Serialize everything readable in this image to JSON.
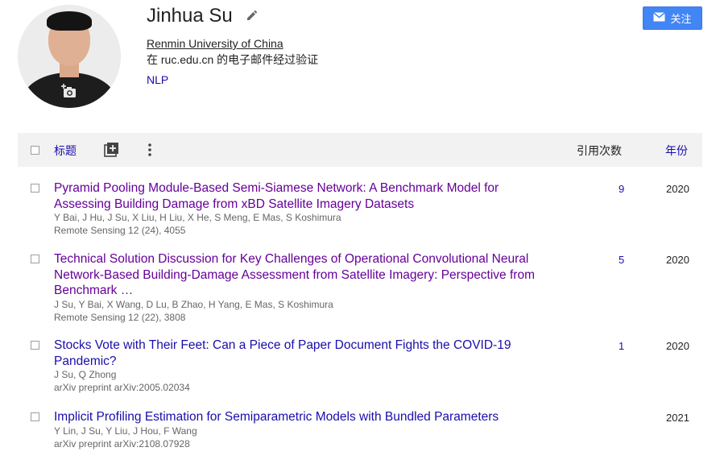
{
  "colors": {
    "link": "#1a0dab",
    "visited": "#660099",
    "accent": "#4285f4"
  },
  "profile": {
    "name": "Jinhua Su",
    "affiliation": "Renmin University of China",
    "verified": "在 ruc.edu.cn 的电子邮件经过验证",
    "interest": "NLP",
    "icons": {
      "edit": "pencil-icon",
      "camera": "add-photo-icon"
    }
  },
  "follow": {
    "label": "关注",
    "icon": "mail-icon"
  },
  "table": {
    "title_header": "标题",
    "cited_header": "引用次数",
    "year_header": "年份",
    "icons": {
      "add": "add-box-icon",
      "more": "more-vert-icon"
    }
  },
  "articles": [
    {
      "title": "Pyramid Pooling Module-Based Semi-Siamese Network: A Benchmark Model for Assessing Building Damage from xBD Satellite Imagery Datasets",
      "authors": "Y Bai, J Hu, J Su, X Liu, H Liu, X He, S Meng, E Mas, S Koshimura",
      "venue": "Remote Sensing 12 (24), 4055",
      "cited": "9",
      "year": "2020"
    },
    {
      "title": "Technical Solution Discussion for Key Challenges of Operational Convolutional Neural Network-Based Building-Damage Assessment from Satellite Imagery: Perspective from Benchmark …",
      "authors": "J Su, Y Bai, X Wang, D Lu, B Zhao, H Yang, E Mas, S Koshimura",
      "venue": "Remote Sensing 12 (22), 3808",
      "cited": "5",
      "year": "2020"
    },
    {
      "title": "Stocks Vote with Their Feet: Can a Piece of Paper Document Fights the COVID-19 Pandemic?",
      "authors": "J Su, Q Zhong",
      "venue": "arXiv preprint arXiv:2005.02034",
      "cited": "1",
      "year": "2020"
    },
    {
      "title": "Implicit Profiling Estimation for Semiparametric Models with Bundled Parameters",
      "authors": "Y Lin, J Su, Y Liu, J Hou, F Wang",
      "venue": "arXiv preprint arXiv:2108.07928",
      "cited": "",
      "year": "2021"
    }
  ]
}
